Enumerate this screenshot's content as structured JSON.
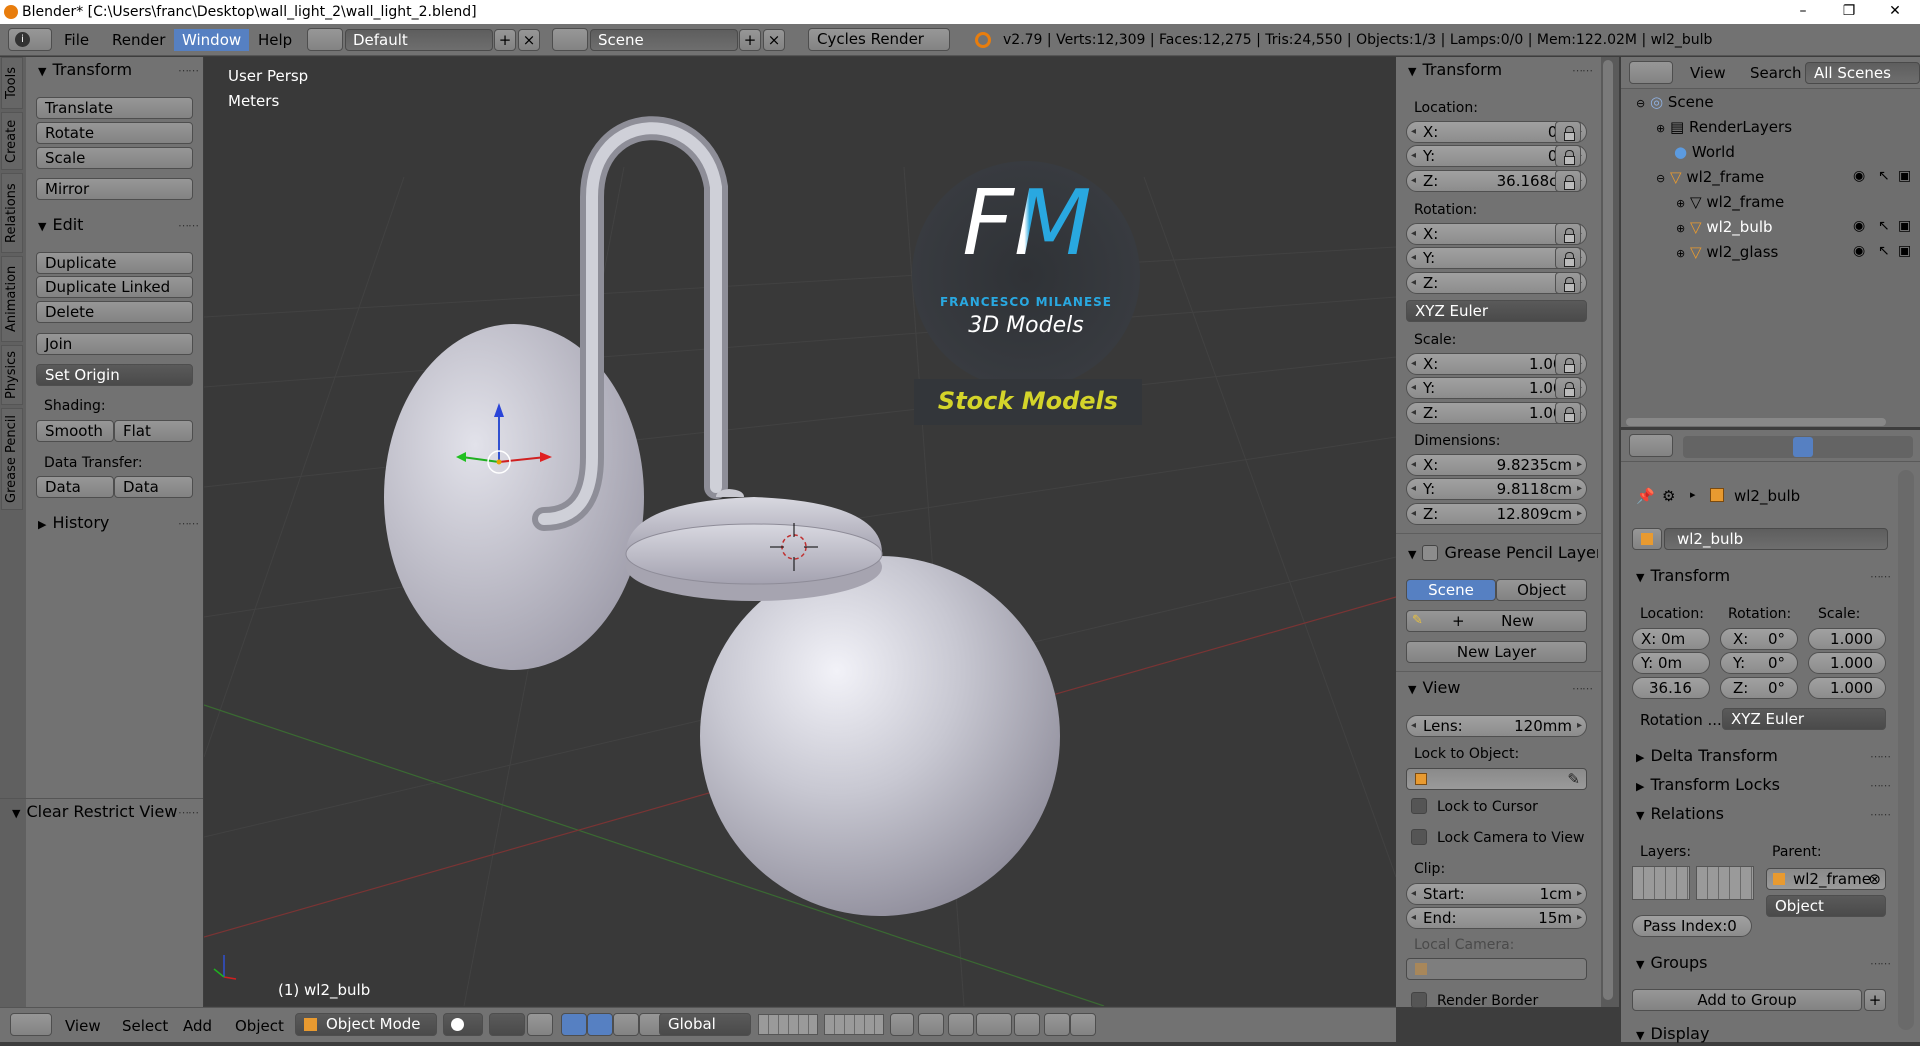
{
  "window": {
    "title": "Blender* [C:\\Users\\franc\\Desktop\\wall_light_2\\wall_light_2.blend]",
    "controls": [
      "–",
      "❐",
      "✕"
    ]
  },
  "topbar": {
    "menus": [
      "File",
      "Render",
      "Window",
      "Help"
    ],
    "layout": "Default",
    "scene": "Scene",
    "engine": "Cycles Render",
    "stats": "v2.79 | Verts:12,309 | Faces:12,275 | Tris:24,550 | Objects:1/3 | Lamps:0/0 | Mem:122.02M | wl2_bulb"
  },
  "tool_tabs": [
    "Tools",
    "Create",
    "Relations",
    "Animation",
    "Physics",
    "Grease Pencil"
  ],
  "toolshelf": {
    "transform_header": "Transform",
    "translate": "Translate",
    "rotate": "Rotate",
    "scale": "Scale",
    "mirror": "Mirror",
    "edit_header": "Edit",
    "duplicate": "Duplicate",
    "duplicate_linked": "Duplicate Linked",
    "delete": "Delete",
    "join": "Join",
    "set_origin": "Set Origin",
    "shading_label": "Shading:",
    "smooth": "Smooth",
    "flat": "Flat",
    "data_transfer_label": "Data Transfer:",
    "data": "Data",
    "data_layout": "Data Layo",
    "history": "History",
    "clear_restrict": "Clear Restrict View"
  },
  "viewport": {
    "view_name": "User Persp",
    "units": "Meters",
    "object_label": "(1) wl2_bulb",
    "watermark_line1": "FM",
    "watermark_line2": "FRANCESCO MILANESE",
    "watermark_line3": "3D Models",
    "watermark_banner": "Stock Models"
  },
  "npanel": {
    "transform_header": "Transform",
    "location_label": "Location:",
    "loc_x": {
      "k": "X:",
      "v": "0m"
    },
    "loc_y": {
      "k": "Y:",
      "v": "0m"
    },
    "loc_z": {
      "k": "Z:",
      "v": "36.168cm"
    },
    "rotation_label": "Rotation:",
    "rot_x": {
      "k": "X:",
      "v": "0°"
    },
    "rot_y": {
      "k": "Y:",
      "v": "0°"
    },
    "rot_z": {
      "k": "Z:",
      "v": "0°"
    },
    "rotation_mode": "XYZ Euler",
    "scale_label": "Scale:",
    "scl_x": {
      "k": "X:",
      "v": "1.000"
    },
    "scl_y": {
      "k": "Y:",
      "v": "1.000"
    },
    "scl_z": {
      "k": "Z:",
      "v": "1.000"
    },
    "dimensions_label": "Dimensions:",
    "dim_x": {
      "k": "X:",
      "v": "9.8235cm"
    },
    "dim_y": {
      "k": "Y:",
      "v": "9.8118cm"
    },
    "dim_z": {
      "k": "Z:",
      "v": "12.809cm"
    },
    "grease_header": "Grease Pencil Layer",
    "gp_scene": "Scene",
    "gp_object": "Object",
    "gp_new": "New",
    "gp_new_layer": "New Layer",
    "view_header": "View",
    "lens": {
      "k": "Lens:",
      "v": "120mm"
    },
    "lock_to_object": "Lock to Object:",
    "lock_to_cursor": "Lock to Cursor",
    "lock_camera": "Lock Camera to View",
    "clip_label": "Clip:",
    "clip_start": {
      "k": "Start:",
      "v": "1cm"
    },
    "clip_end": {
      "k": "End:",
      "v": "15m"
    },
    "local_camera": "Local Camera:",
    "render_border": "Render Border"
  },
  "outliner": {
    "view": "View",
    "search": "Search",
    "filter": "All Scenes",
    "rows": [
      "Scene",
      "RenderLayers",
      "World",
      "wl2_frame",
      "wl2_frame",
      "wl2_bulb",
      "wl2_glass"
    ]
  },
  "properties": {
    "object_name": "wl2_bulb",
    "breadcrumb": "wl2_bulb",
    "transform_header": "Transform",
    "location_label": "Location:",
    "rotation_label": "Rotation:",
    "scale_label": "Scale:",
    "loc": [
      "X: 0m",
      "Y: 0m",
      "36.16"
    ],
    "rot": [
      "X:",
      "0°",
      "Y:",
      "0°",
      "Z:",
      "0°"
    ],
    "scl": [
      "1.000",
      "1.000",
      "1.000"
    ],
    "rotation_mode_label": "Rotation ...",
    "rotation_mode": "XYZ Euler",
    "delta": "Delta Transform",
    "locks": "Transform Locks",
    "relations": "Relations",
    "layers_label": "Layers:",
    "parent_label": "Parent:",
    "parent": "wl2_frame",
    "parent_type": "Object",
    "pass_index": "Pass Index:0",
    "groups": "Groups",
    "add_group": "Add to Group",
    "display": "Display"
  },
  "bottombar": {
    "menus": [
      "View",
      "Select",
      "Add",
      "Object"
    ],
    "mode": "Object Mode",
    "orientation": "Global"
  }
}
